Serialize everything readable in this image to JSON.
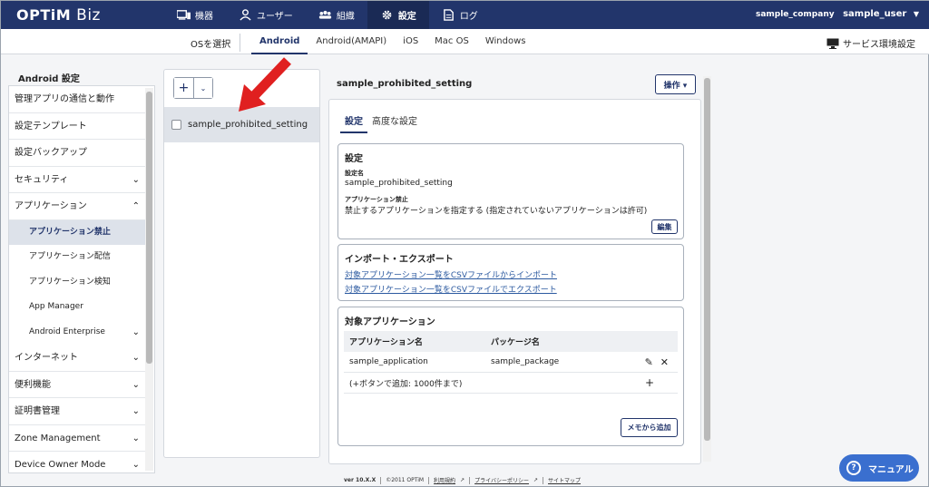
{
  "header": {
    "logo": "OPTiM",
    "logo_sub": "Biz",
    "nav": [
      {
        "label": "機器",
        "icon": "devices-icon"
      },
      {
        "label": "ユーザー",
        "icon": "user-icon"
      },
      {
        "label": "組織",
        "icon": "organization-icon"
      },
      {
        "label": "設定",
        "icon": "gear-icon"
      },
      {
        "label": "ログ",
        "icon": "log-document-icon"
      }
    ],
    "company": "sample_company",
    "user": "sample_user"
  },
  "subheader": {
    "os_select_label": "OSを選択",
    "os_tabs": [
      "Android",
      "Android(AMAPI)",
      "iOS",
      "Mac OS",
      "Windows"
    ],
    "active_os": "Android",
    "service_env_label": "サービス環境設定"
  },
  "sidebar": {
    "title": "Android 設定",
    "items": [
      {
        "label": "管理アプリの通信と動作"
      },
      {
        "label": "設定テンプレート"
      },
      {
        "label": "設定バックアップ"
      },
      {
        "label": "セキュリティ",
        "caret": "⌄"
      },
      {
        "label": "アプリケーション",
        "caret": "⌃"
      },
      {
        "label": "アプリケーション禁止",
        "sub": true,
        "active": true
      },
      {
        "label": "アプリケーション配信",
        "sub": true
      },
      {
        "label": "アプリケーション検知",
        "sub": true
      },
      {
        "label": "App Manager",
        "sub": true
      },
      {
        "label": "Android Enterprise",
        "sub": true,
        "caret": "⌄"
      },
      {
        "label": "インターネット",
        "caret": "⌄"
      },
      {
        "label": "便利機能",
        "caret": "⌄"
      },
      {
        "label": "証明書管理",
        "caret": "⌄"
      },
      {
        "label": "Zone Management",
        "caret": "⌄"
      },
      {
        "label": "Device Owner Mode",
        "caret": "⌄"
      }
    ]
  },
  "list_panel": {
    "add_symbol": "+",
    "dropdown_symbol": "⌄",
    "items": [
      "sample_prohibited_setting"
    ]
  },
  "detail": {
    "title": "sample_prohibited_setting",
    "operation_button": "操作 ▾",
    "tabs": [
      "設定",
      "高度な設定"
    ],
    "settings_card": {
      "heading": "設定",
      "name_label": "設定名",
      "name_value": "sample_prohibited_setting",
      "prohibit_label": "アプリケーション禁止",
      "prohibit_value": "禁止するアプリケーションを指定する (指定されていないアプリケーションは許可)",
      "edit_button": "編集"
    },
    "import_card": {
      "heading": "インポート・エクスポート",
      "import_link": "対象アプリケーション一覧をCSVファイルからインポート",
      "export_link": "対象アプリケーション一覧をCSVファイルでエクスポート"
    },
    "target_card": {
      "heading": "対象アプリケーション",
      "columns": [
        "アプリケーション名",
        "パッケージ名"
      ],
      "rows": [
        {
          "app": "sample_application",
          "package": "sample_package"
        }
      ],
      "add_hint": "(+ボタンで追加: 1000件まで)",
      "memo_button": "メモから追加"
    }
  },
  "footer": {
    "version": "ver 10.X.X",
    "copyright": "©2011 OPTiM",
    "terms": "利用規約",
    "privacy": "プライバシーポリシー",
    "sitemap": "サイトマップ"
  },
  "manual_button": "マニュアル",
  "colors": {
    "header_bg": "#22356b",
    "accent": "#22356b",
    "manual_bg": "#3a6fcf",
    "arrow": "#e02020"
  }
}
